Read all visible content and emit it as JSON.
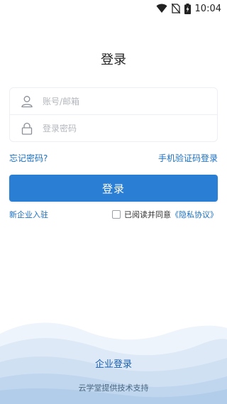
{
  "status_bar": {
    "time": "10:04"
  },
  "page": {
    "title": "登录"
  },
  "form": {
    "account": {
      "placeholder": "账号/邮箱",
      "value": ""
    },
    "password": {
      "placeholder": "登录密码",
      "value": ""
    }
  },
  "links": {
    "forgot_password": "忘记密码?",
    "sms_login": "手机验证码登录"
  },
  "login_button": {
    "label": "登录"
  },
  "register": {
    "label": "新企业入驻"
  },
  "agreement": {
    "checked": false,
    "prefix": "已阅读并同意",
    "link": "《隐私协议》"
  },
  "footer": {
    "enterprise_login": "企业登录",
    "support_text": "云学堂提供技术支持"
  },
  "colors": {
    "accent": "#2a7fd4",
    "link": "#1a6fc1",
    "wave_light": "#e3eef9",
    "wave_dark": "#b9d4ee"
  }
}
